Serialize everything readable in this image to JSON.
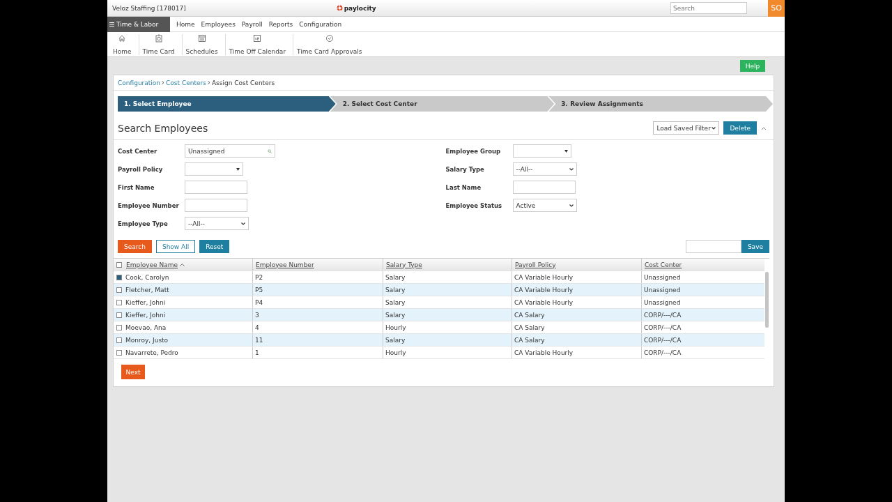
{
  "header": {
    "company": "Veloz Staffing [178017]",
    "logo": "paylocity",
    "search": {
      "placeholder": "Search"
    },
    "avatar": "SO"
  },
  "nav": {
    "module": "Time & Labor",
    "links": [
      "Home",
      "Employees",
      "Payroll",
      "Reports",
      "Configuration"
    ]
  },
  "toolbar": [
    {
      "label": "Home",
      "kind": "home"
    },
    {
      "label": "Time Card",
      "kind": "timecard"
    },
    {
      "label": "Schedules",
      "kind": "schedules"
    },
    {
      "label": "Time Off Calendar",
      "kind": "calendar"
    },
    {
      "label": "Time Card Approvals",
      "kind": "approvals"
    }
  ],
  "help": "Help",
  "breadcrumb": {
    "links": [
      "Configuration",
      "Cost Centers"
    ],
    "current": "Assign Cost Centers"
  },
  "steps": [
    {
      "label": "1. Select Employee",
      "selected": true
    },
    {
      "label": "2. Select Cost Center",
      "selected": false
    },
    {
      "label": "3. Review Assignments",
      "selected": false
    }
  ],
  "section": {
    "title": "Search Employees",
    "saved_filter": "Load Saved Filter",
    "delete": "Delete",
    "expanded": true
  },
  "filters_left": [
    {
      "label": "Cost Center",
      "kind": "lookup",
      "value": "Unassigned"
    },
    {
      "label": "Payroll Policy",
      "kind": "combo"
    },
    {
      "label": "First Name",
      "kind": "text"
    },
    {
      "label": "Employee Number",
      "kind": "text"
    },
    {
      "label": "Employee Type",
      "kind": "select",
      "value": "--All--"
    }
  ],
  "filters_right": [
    {
      "label": "Employee Group",
      "kind": "combo"
    },
    {
      "label": "Salary Type",
      "kind": "select",
      "value": "--All--"
    },
    {
      "label": "Last Name",
      "kind": "text"
    },
    {
      "label": "Employee Status",
      "kind": "select",
      "value": "Active"
    }
  ],
  "buttons": [
    {
      "label": "Search",
      "kind": "primary"
    },
    {
      "label": "Show All",
      "kind": "outline"
    },
    {
      "label": "Reset",
      "kind": "secondary"
    }
  ],
  "save": "Save",
  "table": {
    "all_checked": false,
    "columns": [
      {
        "label": "Employee Name",
        "sorted": true
      },
      {
        "label": "Employee Number",
        "sorted": false
      },
      {
        "label": "Salary Type",
        "sorted": false
      },
      {
        "label": "Payroll Policy",
        "sorted": false
      },
      {
        "label": "Cost Center",
        "sorted": false
      }
    ],
    "rows": [
      {
        "checked": true,
        "cells": [
          "Cook, Carolyn",
          "P2",
          "Salary",
          "CA Variable Hourly",
          "Unassigned"
        ]
      },
      {
        "checked": false,
        "cells": [
          "Fletcher, Matt",
          "P5",
          "Salary",
          "CA Variable Hourly",
          "Unassigned"
        ]
      },
      {
        "checked": false,
        "cells": [
          "Kieffer, Johni",
          "P4",
          "Salary",
          "CA Variable Hourly",
          "Unassigned"
        ]
      },
      {
        "checked": false,
        "cells": [
          "Kieffer, Johni",
          "3",
          "Salary",
          "CA Salary",
          "CORP/---/CA"
        ]
      },
      {
        "checked": false,
        "cells": [
          "Moevao, Ana",
          "4",
          "Hourly",
          "CA Salary",
          "CORP/---/CA"
        ]
      },
      {
        "checked": false,
        "cells": [
          "Monroy, Justo",
          "11",
          "Salary",
          "CA Salary",
          "CORP/---/CA"
        ]
      },
      {
        "checked": false,
        "cells": [
          "Navarrete, Pedro",
          "1",
          "Hourly",
          "CA Variable Hourly",
          "CORP/---/CA"
        ]
      }
    ]
  },
  "next": "Next"
}
